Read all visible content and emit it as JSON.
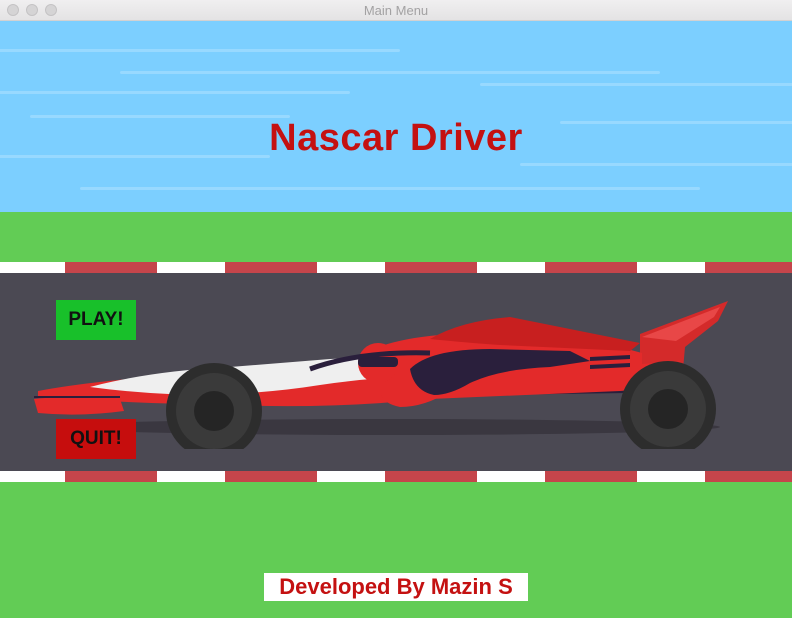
{
  "window": {
    "title": "Main Menu"
  },
  "game": {
    "title": "Nascar Driver",
    "credits": "Developed By Mazin S"
  },
  "menu": {
    "play_label": "PLAY!",
    "quit_label": "QUIT!"
  },
  "colors": {
    "sky": "#7ccfff",
    "grass": "#62cc55",
    "road": "#4b4953",
    "curb_red": "#c5454b",
    "title_red": "#c41111",
    "play_green": "#18c02a",
    "quit_red": "#c60d0d"
  },
  "icons": {
    "close": "close-icon",
    "minimize": "minimize-icon",
    "maximize": "maximize-icon"
  }
}
